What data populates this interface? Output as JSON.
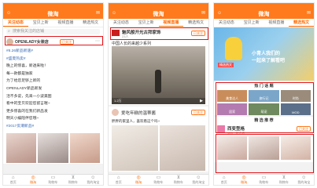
{
  "phone1": {
    "title": "微淘",
    "tabs": [
      "关注动态",
      "宝贝上新",
      "视频直播",
      "精选热文"
    ],
    "search_placeholder": "搜索我关注的店铺",
    "account_name": "OPENLADY女装店",
    "account_badge": "已关注",
    "post_lines": [
      "#8.26新品新速#",
      "#盛夏热卖#",
      "晚上的惊喜，新透来啦！",
      "每一款都是独家",
      "为了给您足够上新的",
      "OPENLADY新品新发",
      "活不多说，先来一小波美图",
      "看中的宝贝欢迎您留言喔~",
      "更多惊喜的在我们新品发",
      "明天小编陪伴您哦~",
      "#2017反潮新品#"
    ],
    "post_time": "9小时前"
  },
  "phone2": {
    "title": "微淘",
    "tabs": [
      "关注动态",
      "宝贝上新",
      "视频直播",
      "精选热文"
    ],
    "live1_shop": "魅风般开光古拜家饰",
    "live1_badge": "已关注",
    "live1_sub": "23人",
    "live1_caption": "中国人长的来越少系列",
    "live1_views": "1.2万",
    "live2_shop": "爱吃年糕的温蒂酱",
    "live2_badge": "已关注",
    "live2_caption": "胖胖的家里人，喜欢看这个吗~"
  },
  "phone3": {
    "title": "微淘",
    "tabs": [
      "关注动态",
      "宝贝上新",
      "视频直播",
      "精选热文"
    ],
    "banner_text1": "小青人我们的",
    "banner_text2": "一起来了解看吧",
    "banner_tag": "精选热文",
    "hot_title": "热 门 话 题",
    "topics": [
      "美食达人",
      "旅行记",
      "时尚",
      "居家",
      "萌宠",
      "MOD"
    ],
    "more_title": "精 选 推 荐",
    "shop_name": "西变型格",
    "shop_badge": "已关注",
    "shop_sub": "123 · 关注者"
  },
  "nav": [
    "首页",
    "微淘",
    "购物车",
    "购物车",
    "我的淘宝"
  ],
  "colors": {
    "accent": "#ff7a1c",
    "highlight": "#e0161b"
  }
}
